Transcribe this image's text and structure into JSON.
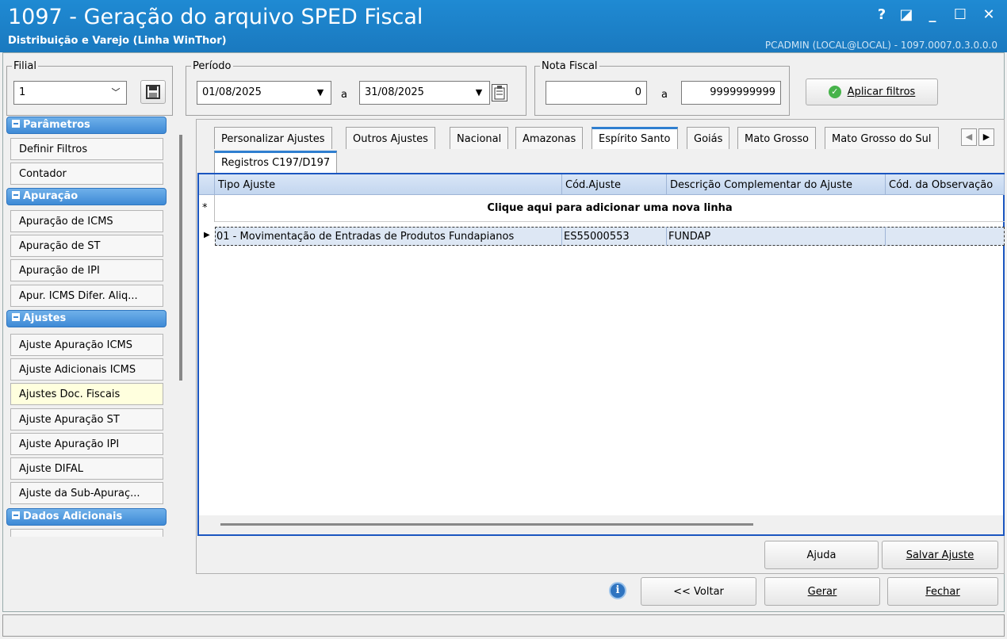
{
  "window": {
    "title": "1097 - Geração do arquivo SPED Fiscal",
    "subtitle": "Distribuição e Varejo (Linha WinThor)",
    "user_info": "PCADMIN (LOCAL@LOCAL) - 1097.0007.0.3.0.0.0",
    "controls": [
      "?",
      "◪",
      "_",
      "☐",
      "✕"
    ]
  },
  "filters": {
    "filial_label": "Filial",
    "filial_value": "1",
    "periodo_label": "Período",
    "data_inicio": "01/08/2025",
    "separator": "a",
    "data_fim": "31/08/2025",
    "nota_label": "Nota Fiscal",
    "nota_inicio": "0",
    "nota_fim": "9999999999",
    "aplicar_label": "Aplicar filtros"
  },
  "sidebar": {
    "groups": [
      {
        "label": "Parâmetros",
        "items": [
          "Definir Filtros",
          "Contador"
        ]
      },
      {
        "label": "Apuração",
        "items": [
          "Apuração de ICMS",
          "Apuração de ST",
          "Apuração de IPI",
          "Apur. ICMS Difer. Aliq..."
        ]
      },
      {
        "label": "Ajustes",
        "items": [
          "Ajuste Apuração ICMS",
          "Ajuste Adicionais ICMS",
          "Ajustes Doc. Fiscais",
          "Ajuste Apuração ST",
          "Ajuste Apuração IPI",
          "Ajuste DIFAL",
          "Ajuste da Sub-Apuraç..."
        ]
      },
      {
        "label": "Dados Adicionais",
        "items": []
      }
    ],
    "active_item": "Ajustes Doc. Fiscais"
  },
  "tabs": [
    "Personalizar Ajustes",
    "Outros Ajustes",
    "Nacional",
    "Amazonas",
    "Espírito Santo",
    "Goiás",
    "Mato Grosso",
    "Mato Grosso do Sul"
  ],
  "selected_tab": "Espírito Santo",
  "subtab": "Registros C197/D197",
  "grid": {
    "columns": [
      "Tipo Ajuste",
      "Cód.Ajuste",
      "Descrição Complementar do Ajuste",
      "Cód. da Observação"
    ],
    "new_row_text": "Clique aqui para adicionar uma nova linha",
    "new_row_marker": "*",
    "current_marker": "▶",
    "rows": [
      {
        "tipo": "01 - Movimentação de Entradas de Produtos Fundapianos",
        "cod": "ES55000553",
        "descricao": "FUNDAP",
        "obs": ""
      }
    ]
  },
  "buttons": {
    "ajuda": "Ajuda",
    "salvar": "Salvar Ajuste",
    "voltar": "<< Voltar",
    "gerar": "Gerar",
    "fechar": "Fechar"
  }
}
